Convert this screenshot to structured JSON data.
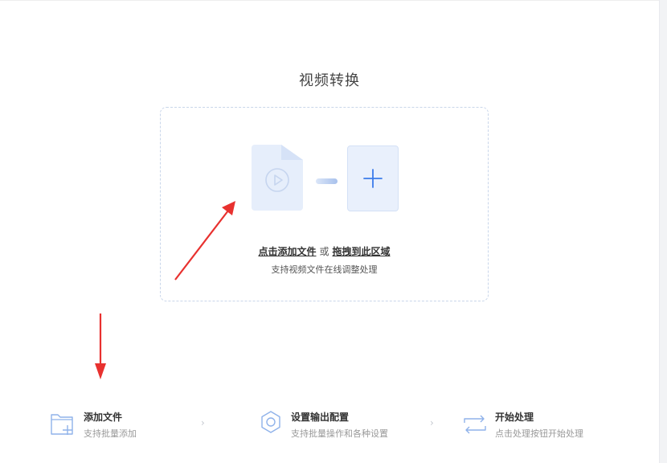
{
  "title": "视频转换",
  "drop_zone": {
    "link_add": "点击添加文件",
    "or": "或",
    "link_drag": "拖拽到此区域",
    "subtitle": "支持视频文件在线调整处理"
  },
  "steps": [
    {
      "title": "添加文件",
      "desc": "支持批量添加",
      "icon": "folder-add-icon"
    },
    {
      "title": "设置输出配置",
      "desc": "支持批量操作和各种设置",
      "icon": "gear-icon"
    },
    {
      "title": "开始处理",
      "desc": "点击处理按钮开始处理",
      "icon": "repeat-icon"
    }
  ],
  "separator": "›",
  "colors": {
    "accent": "#3b7bea",
    "annotation": "#e8312f",
    "tile": "#e6eefb"
  }
}
